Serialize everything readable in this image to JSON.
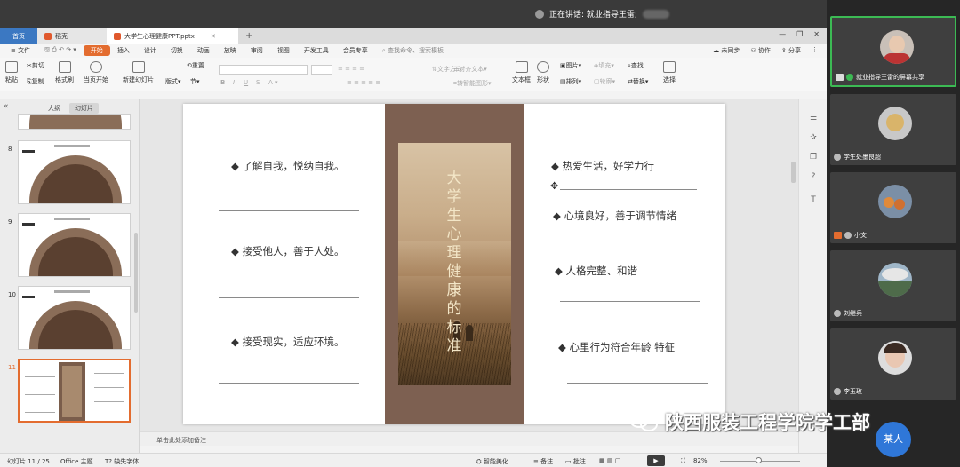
{
  "meeting": {
    "speaking_label": "正在讲话: 就业指导王雷;"
  },
  "tabs": {
    "home": "首页",
    "draft": "稻壳",
    "document": "大学生心理健康PPT.pptx"
  },
  "menu": {
    "file": "≡ 文件",
    "items": [
      "开始",
      "插入",
      "设计",
      "切换",
      "动画",
      "放映",
      "审阅",
      "视图",
      "开发工具",
      "会员专享"
    ],
    "search": "查找命令、搜索模板",
    "unsync": "未同步",
    "collab": "协作",
    "share": "分享"
  },
  "ribbon": {
    "paste": "粘贴",
    "cut": "剪切",
    "copy": "复制",
    "format_painter": "格式刷",
    "from_current": "当页开始",
    "new_slide": "新建幻灯片",
    "layout": "版式",
    "section": "节",
    "reset": "重置",
    "text_direction": "文字方向",
    "align_text": "对齐文本",
    "smart_art": "转智能图形",
    "textbox": "文本框",
    "shape": "形状",
    "arrange": "排列",
    "picture": "图片",
    "fill": "填充",
    "outline": "轮廓",
    "find": "查找",
    "replace": "替换",
    "select": "选择"
  },
  "leftpanel": {
    "tab_outline": "大纲",
    "tab_slides": "幻灯片",
    "slides": [
      {
        "num": "8"
      },
      {
        "num": "9"
      },
      {
        "num": "10"
      },
      {
        "num": "11"
      }
    ],
    "add": "+"
  },
  "slide": {
    "vertical_title": [
      "大",
      "学",
      "生",
      "心",
      "理",
      "健",
      "康",
      "的",
      "标",
      "准"
    ],
    "left_items": [
      "◆ 了解自我，悦纳自我。",
      "◆ 接受他人，善于人处。",
      "◆ 接受现实，适应环境。"
    ],
    "right_items": [
      "◆ 热爱生活，好学力行",
      "◆ 心境良好，善于调节情绪",
      "◆ 人格完整、和谐",
      "◆ 心里行为符合年龄 特征"
    ]
  },
  "notes": {
    "placeholder": "单击此处添加备注"
  },
  "status": {
    "slide_count": "幻灯片 11 / 25",
    "theme": "Office 主题",
    "missing_font": "缺失字体",
    "beautify": "智能美化",
    "notes": "备注",
    "comments": "批注",
    "zoom": "82%"
  },
  "participants": [
    {
      "name": "就业指导王雷的屏幕共享",
      "active": true
    },
    {
      "name": "学生处墨良超",
      "active": false
    },
    {
      "name": "小文",
      "active": false
    },
    {
      "name": "刘继兵",
      "active": false
    },
    {
      "name": "李玉玫",
      "active": false
    }
  ],
  "watermark": "陕西服装工程学院学工部",
  "join_button": "某人"
}
